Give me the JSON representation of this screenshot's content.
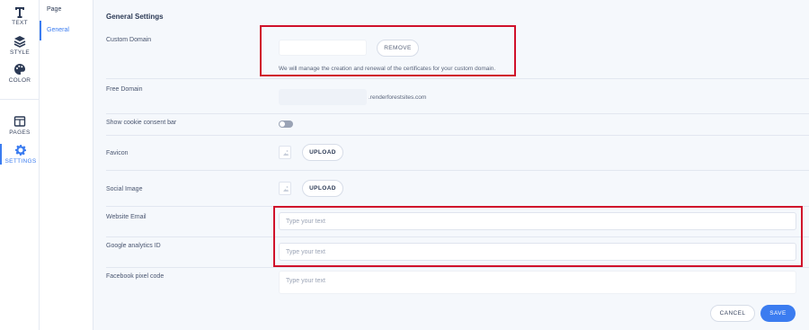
{
  "rail": {
    "text": "TEXT",
    "style": "STYLE",
    "color": "COLOR",
    "pages": "PAGES",
    "settings": "SETTINGS"
  },
  "pages_panel": {
    "page": "Page",
    "general": "General"
  },
  "main": {
    "title": "General Settings",
    "custom_domain": {
      "label": "Custom Domain",
      "value": "",
      "remove": "REMOVE",
      "note": "We will manage the creation and renewal of the certificates for your custom domain."
    },
    "free_domain": {
      "label": "Free Domain",
      "value": "",
      "suffix": ".renderforestsites.com"
    },
    "cookie": {
      "label": "Show cookie consent bar",
      "enabled": false
    },
    "favicon": {
      "label": "Favicon",
      "upload": "UPLOAD"
    },
    "social_image": {
      "label": "Social Image",
      "upload": "UPLOAD"
    },
    "website_email": {
      "label": "Website Email",
      "placeholder": "Type your text"
    },
    "google_analytics": {
      "label": "Google analytics ID",
      "placeholder": "Type your text"
    },
    "facebook_pixel": {
      "label": "Facebook pixel code",
      "placeholder": "Type your text"
    },
    "cancel": "CANCEL",
    "save": "SAVE"
  },
  "colors": {
    "accent": "#3b7cf0",
    "highlight": "#d0112b"
  }
}
